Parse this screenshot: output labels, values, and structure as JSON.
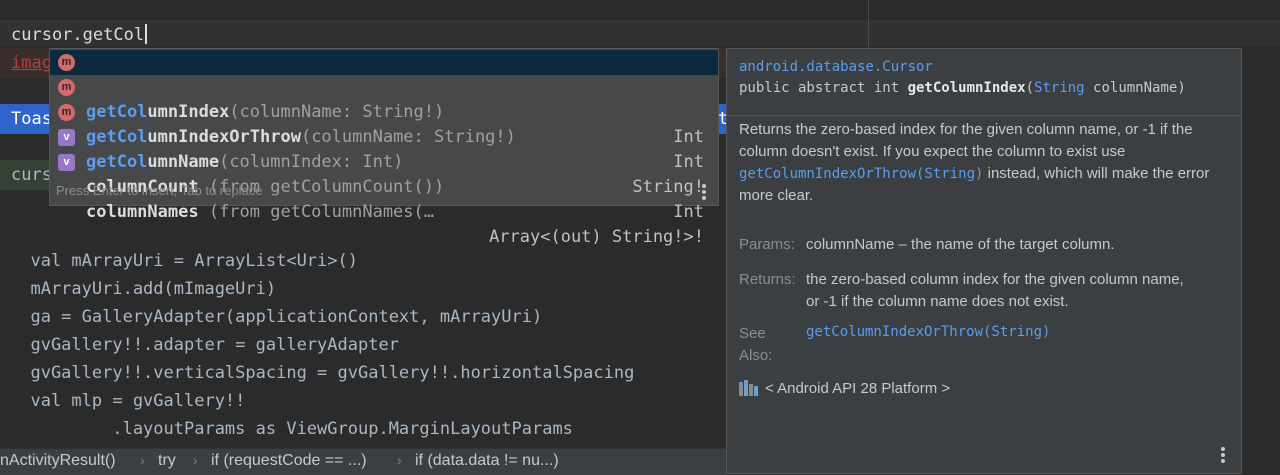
{
  "editor": {
    "current_line": "cursor.getCol",
    "line_image_partial": "imag",
    "line_toast_partial": "Toas",
    "line_toast_tail": "t",
    "line_cursor_partial": "curs",
    "code_lines": [
      "  val mArrayUri = ArrayList<Uri>()",
      "  mArrayUri.add(mImageUri)",
      "  ga = GalleryAdapter(applicationContext, mArrayUri)",
      "  gvGallery!!.adapter = galleryAdapter",
      "  gvGallery!!.verticalSpacing = gvGallery!!.horizontalSpacing",
      "  val mlp = gvGallery!!",
      "          .layoutParams as ViewGroup.MarginLayoutParams"
    ]
  },
  "completion": {
    "items": [
      {
        "icon": "m",
        "match": "getCol",
        "rest": "umnIndex",
        "params": "(columnName: String!)",
        "type": "Int"
      },
      {
        "icon": "m",
        "match": "getCol",
        "rest": "umnIndexOrThrow",
        "params": "(columnName: String!)",
        "type": "Int"
      },
      {
        "icon": "m",
        "match": "getCol",
        "rest": "umnName",
        "params": "(columnIndex: Int)",
        "type": "String!"
      },
      {
        "icon": "v",
        "match": "",
        "rest": "columnCount",
        "params": " (from getColumnCount())",
        "type": "Int"
      },
      {
        "icon": "v",
        "match": "",
        "rest": "columnNames",
        "params": " (from getColumnNames(…",
        "type": "Array<(out) String!>!"
      }
    ],
    "footer": "Press Enter to insert, Tab to replace"
  },
  "doc": {
    "package": "android.database.Cursor",
    "sig_prefix": "public abstract int ",
    "sig_name": "getColumnIndex",
    "sig_paren_open": "(",
    "sig_param_type": "String",
    "sig_param_rest": " columnName)",
    "desc_1": "Returns the zero-based index for the given column name, or -1 if the column doesn't exist. If you expect the column to exist use ",
    "desc_link": "getColumnIndexOrThrow(String)",
    "desc_2": " instead, which will make the error more clear.",
    "params_label": "Params:",
    "params_value": "columnName – the name of the target column.",
    "returns_label": "Returns:",
    "returns_value": "the zero-based column index for the given column name, or -1 if the column name does not exist.",
    "see_label": "See Also:",
    "see_value": "getColumnIndexOrThrow(String)",
    "api_text": "< Android API 28 Platform >"
  },
  "breadcrumbs": [
    "nActivityResult()",
    "try",
    "if (requestCode == ...)",
    "if (data.data != nu...)"
  ],
  "colors": {
    "accent": "#5c9ded",
    "selection": "#2f65ca",
    "error": "#bc3f3c"
  }
}
